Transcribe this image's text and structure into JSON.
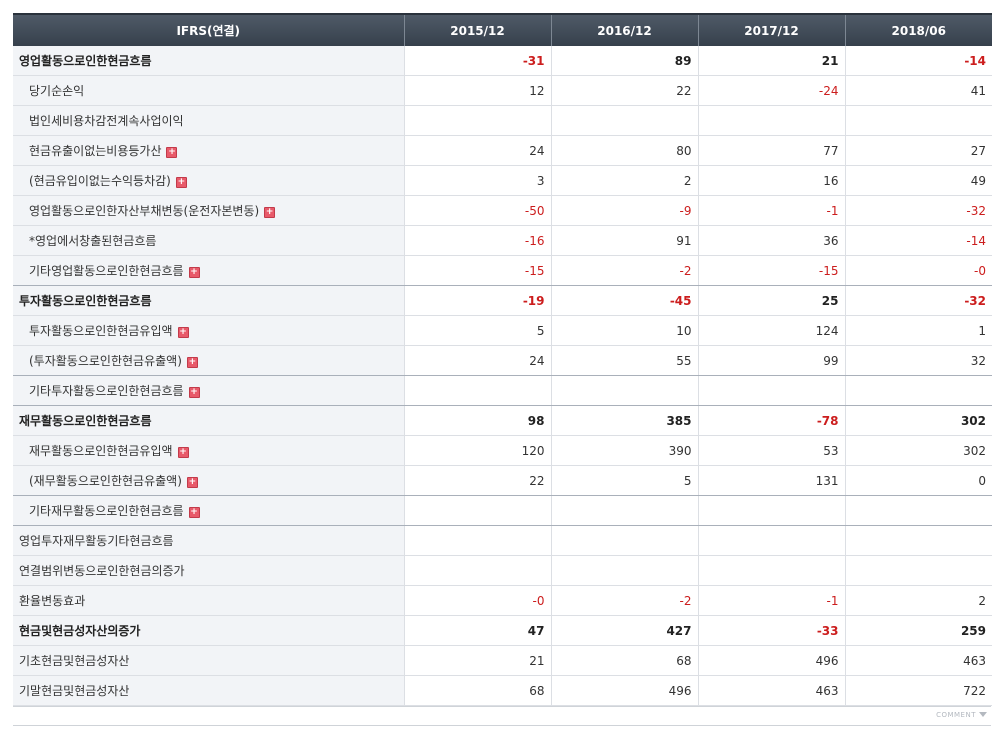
{
  "header": {
    "label_col": "IFRS(연결)",
    "periods": [
      "2015/12",
      "2016/12",
      "2017/12",
      "2018/06"
    ]
  },
  "rows": [
    {
      "label": "영업활동으로인한현금흐름",
      "values": [
        "-31",
        "89",
        "21",
        "-14"
      ],
      "bold": true,
      "indent": false,
      "expand": false
    },
    {
      "label": "당기순손익",
      "values": [
        "12",
        "22",
        "-24",
        "41"
      ],
      "bold": false,
      "indent": true,
      "expand": false
    },
    {
      "label": "법인세비용차감전계속사업이익",
      "values": [
        "",
        "",
        "",
        ""
      ],
      "bold": false,
      "indent": true,
      "expand": false
    },
    {
      "label": "현금유출이없는비용등가산",
      "values": [
        "24",
        "80",
        "77",
        "27"
      ],
      "bold": false,
      "indent": true,
      "expand": true
    },
    {
      "label": "(현금유입이없는수익등차감)",
      "values": [
        "3",
        "2",
        "16",
        "49"
      ],
      "bold": false,
      "indent": true,
      "expand": true
    },
    {
      "label": "영업활동으로인한자산부채변동(운전자본변동)",
      "values": [
        "-50",
        "-9",
        "-1",
        "-32"
      ],
      "bold": false,
      "indent": true,
      "expand": true
    },
    {
      "label": "*영업에서창출된현금흐름",
      "values": [
        "-16",
        "91",
        "36",
        "-14"
      ],
      "bold": false,
      "indent": true,
      "expand": false
    },
    {
      "label": "기타영업활동으로인한현금흐름",
      "values": [
        "-15",
        "-2",
        "-15",
        "-0"
      ],
      "bold": false,
      "indent": true,
      "expand": true,
      "sep": true
    },
    {
      "label": "투자활동으로인한현금흐름",
      "values": [
        "-19",
        "-45",
        "25",
        "-32"
      ],
      "bold": true,
      "indent": false,
      "expand": false
    },
    {
      "label": "투자활동으로인한현금유입액",
      "values": [
        "5",
        "10",
        "124",
        "1"
      ],
      "bold": false,
      "indent": true,
      "expand": true
    },
    {
      "label": "(투자활동으로인한현금유출액)",
      "values": [
        "24",
        "55",
        "99",
        "32"
      ],
      "bold": false,
      "indent": true,
      "expand": true,
      "sep": true
    },
    {
      "label": "기타투자활동으로인한현금흐름",
      "values": [
        "",
        "",
        "",
        ""
      ],
      "bold": false,
      "indent": true,
      "expand": true,
      "sep": true
    },
    {
      "label": "재무활동으로인한현금흐름",
      "values": [
        "98",
        "385",
        "-78",
        "302"
      ],
      "bold": true,
      "indent": false,
      "expand": false
    },
    {
      "label": "재무활동으로인한현금유입액",
      "values": [
        "120",
        "390",
        "53",
        "302"
      ],
      "bold": false,
      "indent": true,
      "expand": true
    },
    {
      "label": "(재무활동으로인한현금유출액)",
      "values": [
        "22",
        "5",
        "131",
        "0"
      ],
      "bold": false,
      "indent": true,
      "expand": true,
      "sep": true
    },
    {
      "label": "기타재무활동으로인한현금흐름",
      "values": [
        "",
        "",
        "",
        ""
      ],
      "bold": false,
      "indent": true,
      "expand": true,
      "sep": true
    },
    {
      "label": "영업투자재무활동기타현금흐름",
      "values": [
        "",
        "",
        "",
        ""
      ],
      "bold": false,
      "indent": false,
      "expand": false
    },
    {
      "label": "연결범위변동으로인한현금의증가",
      "values": [
        "",
        "",
        "",
        ""
      ],
      "bold": false,
      "indent": false,
      "expand": false
    },
    {
      "label": "환율변동효과",
      "values": [
        "-0",
        "-2",
        "-1",
        "2"
      ],
      "bold": false,
      "indent": false,
      "expand": false
    },
    {
      "label": "현금및현금성자산의증가",
      "values": [
        "47",
        "427",
        "-33",
        "259"
      ],
      "bold": true,
      "indent": false,
      "expand": false
    },
    {
      "label": "기초현금및현금성자산",
      "values": [
        "21",
        "68",
        "496",
        "463"
      ],
      "bold": false,
      "indent": false,
      "expand": false
    },
    {
      "label": "기말현금및현금성자산",
      "values": [
        "68",
        "496",
        "463",
        "722"
      ],
      "bold": false,
      "indent": false,
      "expand": false
    }
  ],
  "footer": {
    "comment_label": "COMMENT"
  },
  "colors": {
    "negative": "#cc1d1d",
    "header_bg": "#3c4653",
    "expand_icon": "#e85a6a"
  },
  "icons": {
    "expand": "plus-box-icon",
    "comment_toggle": "triangle-down-icon"
  }
}
